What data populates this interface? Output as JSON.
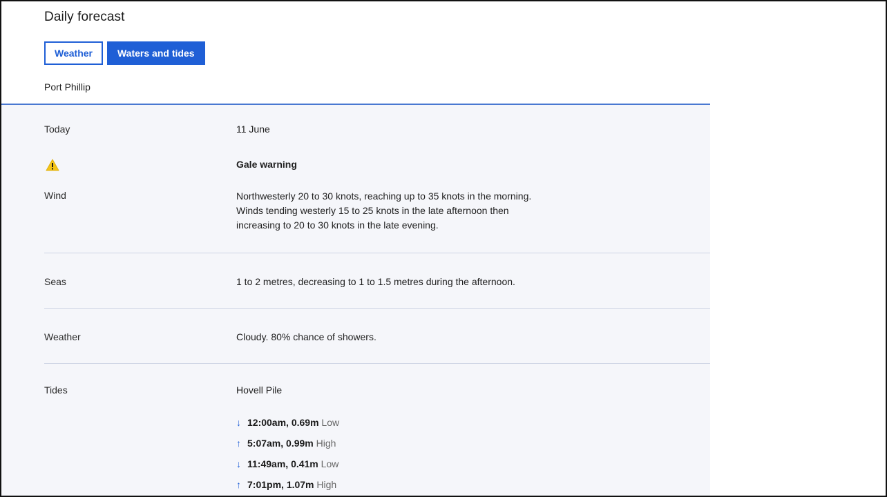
{
  "header": {
    "title": "Daily forecast",
    "tabs": [
      {
        "label": "Weather"
      },
      {
        "label": "Waters and tides"
      }
    ],
    "location": "Port Phillip"
  },
  "forecast": {
    "day_label": "Today",
    "date": "11 June",
    "warning": {
      "icon": "warning-triangle-icon",
      "text": "Gale warning"
    },
    "wind": {
      "label": "Wind",
      "lines": [
        "Northwesterly 20 to 30 knots, reaching up to 35 knots in the morning.",
        "Winds tending westerly 15 to 25 knots in the late afternoon then",
        "increasing to 20 to 30 knots in the late evening."
      ]
    },
    "seas": {
      "label": "Seas",
      "text": "1 to 2 metres, decreasing to 1 to 1.5 metres during the afternoon."
    },
    "weather": {
      "label": "Weather",
      "text": "Cloudy. 80% chance of showers."
    },
    "tides": {
      "label": "Tides",
      "station": "Hovell Pile",
      "entries": [
        {
          "arrow": "↓",
          "icon": "arrow-down-icon",
          "time": "12:00am",
          "height": "0.69m",
          "type": "Low"
        },
        {
          "arrow": "↑",
          "icon": "arrow-up-icon",
          "time": "5:07am",
          "height": "0.99m",
          "type": "High"
        },
        {
          "arrow": "↓",
          "icon": "arrow-down-icon",
          "time": "11:49am",
          "height": "0.41m",
          "type": "Low"
        },
        {
          "arrow": "↑",
          "icon": "arrow-up-icon",
          "time": "7:01pm",
          "height": "1.07m",
          "type": "High"
        }
      ]
    }
  },
  "colors": {
    "accent": "#1f5fd6",
    "content_background": "#f5f6fa",
    "divider": "#cdd4e4",
    "warning": "#f3c318"
  }
}
